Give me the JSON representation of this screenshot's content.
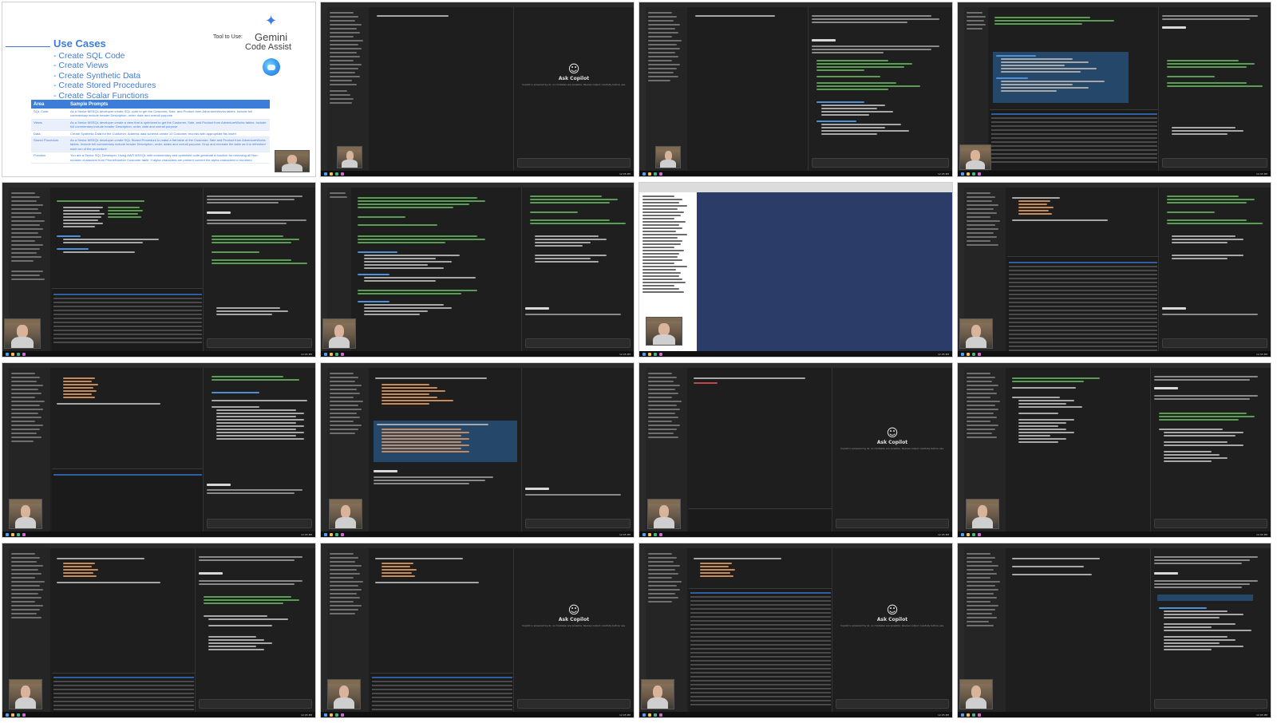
{
  "slide": {
    "title": "Use Cases",
    "bullets": [
      "-  Create SQL Code",
      "-  Create Views",
      "-  Create Synthetic Data",
      "-  Create Stored Procedures",
      "-  Create Scalar Functions"
    ],
    "tool_label": "Tool to Use:",
    "tool_name": "Gemini",
    "tool_sub": "Code Assist",
    "table_headers": [
      "Area",
      "Sample Prompts"
    ],
    "table_rows": [
      {
        "area": "SQL Code",
        "prompt": "As a Senior MSSQL developer create SQL code to get the Customer, Sale, and Product from AdventureWorks tables. Include full commentary include header Description, order, date and overall purpose"
      },
      {
        "area": "Views",
        "prompt": "As a Senior MSSQL developer create a view that is optimized to get the Customer, Sale, and Product from AdventureWorks tables. Include full commentary include header Description, order, date and overall purpose"
      },
      {
        "area": "Data",
        "prompt": "Create Synthetic Data for the Customer, Address data schema create 10 Customer records with appropriate fits insert"
      },
      {
        "area": "Stored Procedure",
        "prompt": "As a Senior MSSQL developer create SQL Stored Procedure to make a flat table of the Customer, Sale and Product from AdventureWorks tables. Include full commentary include header Description, order, dates and overall purpose. Drop and recreate the table as it is refreshed each run of the procedure"
      },
      {
        "area": "Function",
        "prompt": "You are a Senior SQL Developer. Using AWS MSSQL with commentary and optimized code generate a function for removing all Non-numeric characters from PhoneNumber Customer table. If alpha characters are present convert the alpha characters to numbers."
      }
    ]
  },
  "copilot_panel": {
    "title": "Ask Copilot",
    "subtitle": "Copilot is powered by AI, so mistakes are possible. Review output carefully before use."
  },
  "taskbar": {
    "clock": "12:05 PM"
  },
  "colors": {
    "slide_accent": "#3c7dd9",
    "editor_bg": "#1e1e1e",
    "ssms_bg": "#2c3c68"
  }
}
